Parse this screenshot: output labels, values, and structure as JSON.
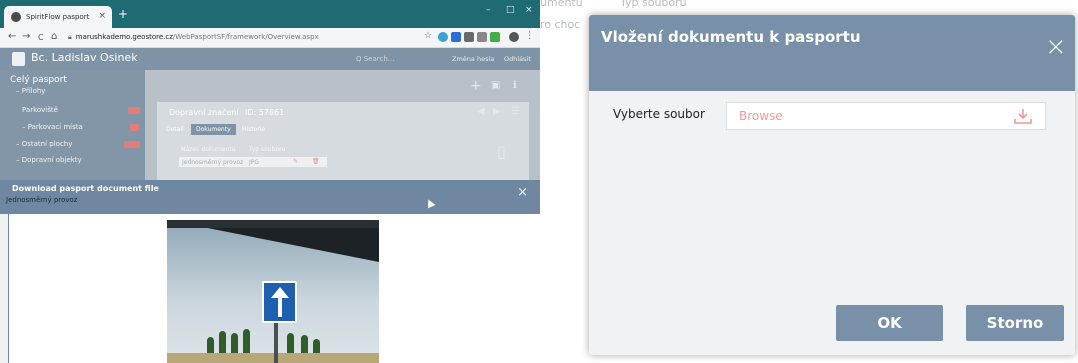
{
  "browser": {
    "tab_title": "SpiritFlow pasport",
    "new_tab": "+",
    "win_min": "–",
    "win_max": "□",
    "win_close": "×",
    "nav_back": "←",
    "nav_forward": "→",
    "nav_reload": "C",
    "nav_home": "⌂",
    "url_host": "marushkademo.geostore.cz",
    "url_path": "/WebPasportSF/framework/Overview.aspx",
    "star": "☆"
  },
  "app": {
    "user_name": "Bc. Ladislav Osinek",
    "search_placeholder": "Q  Search...",
    "link_change_password": "Změna hesla",
    "link_logout": "Odhlásit",
    "sidebar": {
      "title": "Celý pasport",
      "items": [
        "– Přílohy",
        "Parkoviště",
        "– Parkovací místa",
        "– Ostatní plochy",
        "– Dopravní objekty"
      ]
    },
    "detail": {
      "title": "Dopravní značení",
      "id_label": "ID: 57861",
      "tabs": [
        "Detail",
        "Dokumenty",
        "Historie"
      ],
      "col_name": "Název dokumentu",
      "col_type": "Typ souboru",
      "row_name": "Jednosměrný provoz",
      "row_type": "JPG"
    }
  },
  "download_modal": {
    "title": "Download pasport document file",
    "subtitle": "Jednosměrný provoz",
    "close": "×"
  },
  "background_right": {
    "col_name_partial": "umentu",
    "col_type": "Typ souboru",
    "row_partial": "ro choc"
  },
  "upload_modal": {
    "title": "Vložení dokumentu k pasportu",
    "close": "×",
    "field_label": "Vyberte soubor",
    "file_placeholder": "Browse",
    "ok_label": "OK",
    "cancel_label": "Storno",
    "accent_color": "#7990a9"
  }
}
